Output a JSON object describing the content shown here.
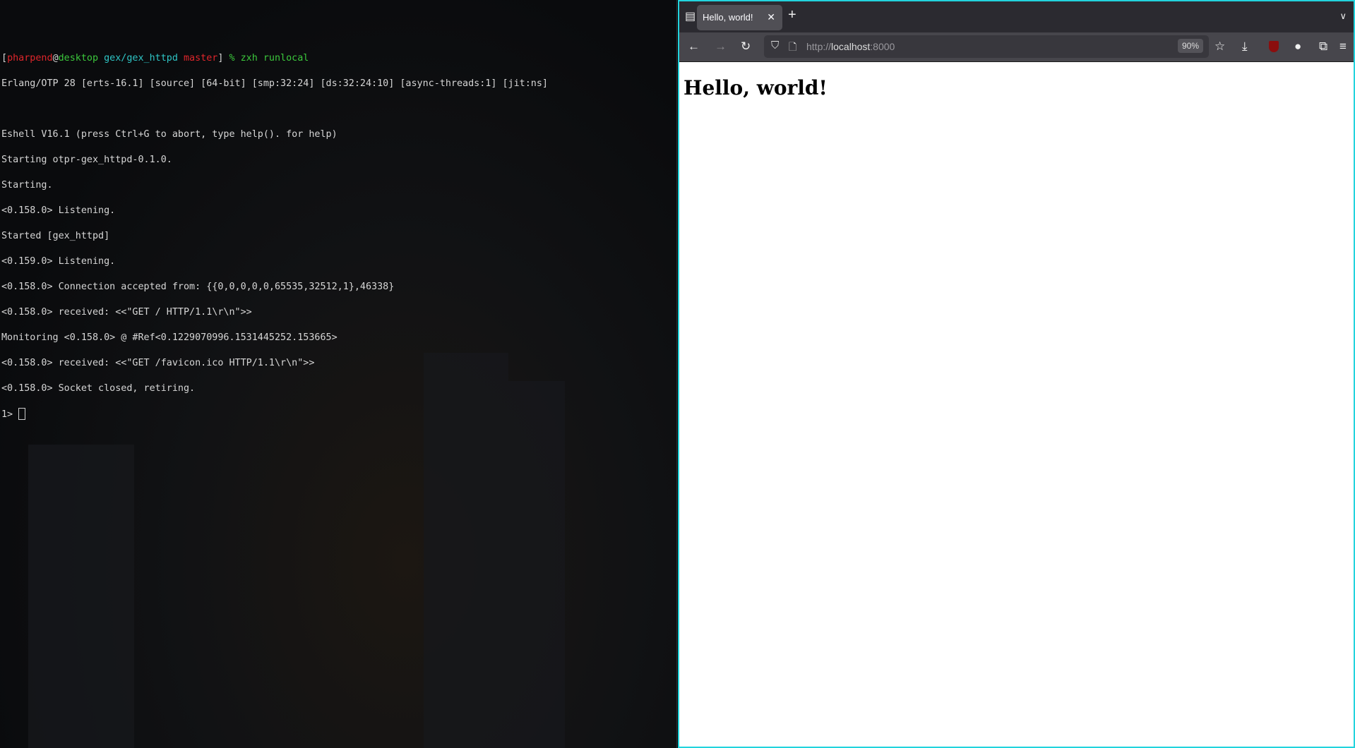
{
  "terminal": {
    "prompt": {
      "user": "pharpend",
      "at": "@",
      "host": "desktop",
      "path": "gex/gex_httpd",
      "branch": "master",
      "symbol": "%",
      "command": "zxh runlocal"
    },
    "lines": [
      "Erlang/OTP 28 [erts-16.1] [source] [64-bit] [smp:32:24] [ds:32:24:10] [async-threads:1] [jit:ns]",
      "",
      "Eshell V16.1 (press Ctrl+G to abort, type help(). for help)",
      "Starting otpr-gex_httpd-0.1.0.",
      "Starting.",
      "<0.158.0> Listening.",
      "Started [gex_httpd]",
      "<0.159.0> Listening.",
      "<0.158.0> Connection accepted from: {{0,0,0,0,0,65535,32512,1},46338}",
      "<0.158.0> received: <<\"GET / HTTP/1.1\\r\\n\">>",
      "Monitoring <0.158.0> @ #Ref<0.1229070996.1531445252.153665>",
      "<0.158.0> received: <<\"GET /favicon.ico HTTP/1.1\\r\\n\">>",
      "<0.158.0> Socket closed, retiring."
    ],
    "shell_prompt": "1>"
  },
  "browser": {
    "tab_title": "Hello, world!",
    "url_prefix": "http://",
    "url_host": "localhost",
    "url_port": ":8000",
    "zoom": "90%",
    "heading": "Hello, world!",
    "accent": "#22d3dd"
  }
}
